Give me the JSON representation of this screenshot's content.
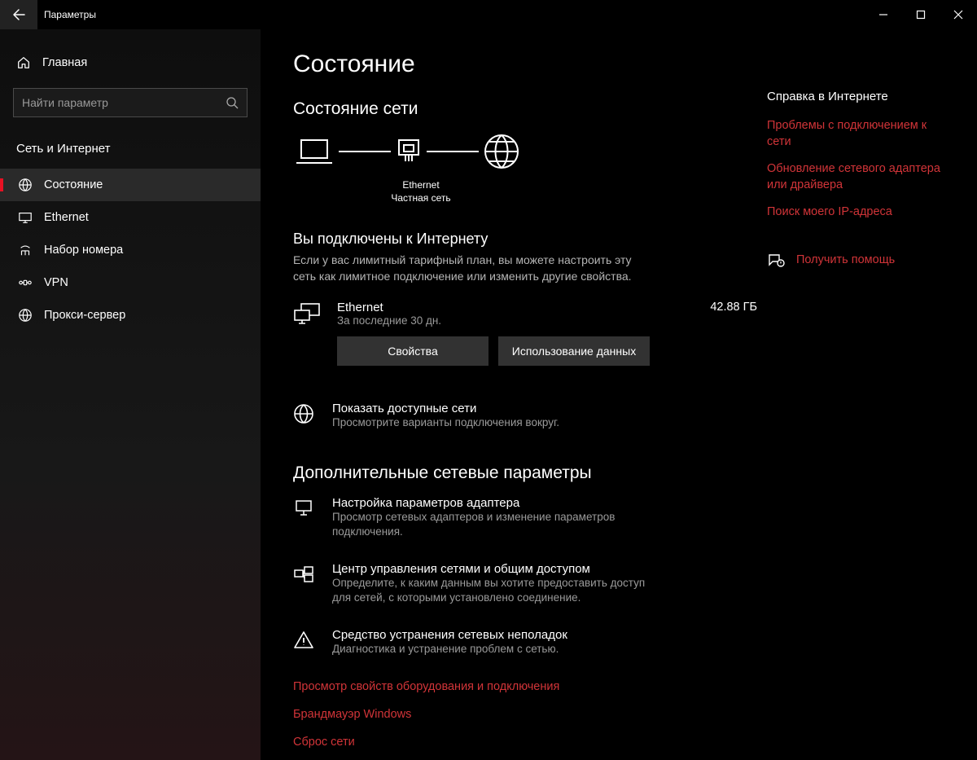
{
  "window": {
    "title": "Параметры"
  },
  "sidebar": {
    "home": "Главная",
    "search_placeholder": "Найти параметр",
    "category": "Сеть и Интернет",
    "items": [
      {
        "label": "Состояние",
        "selected": true
      },
      {
        "label": "Ethernet",
        "selected": false
      },
      {
        "label": "Набор номера",
        "selected": false
      },
      {
        "label": "VPN",
        "selected": false
      },
      {
        "label": "Прокси-сервер",
        "selected": false
      }
    ]
  },
  "main": {
    "page_title": "Состояние",
    "section_network_status": "Состояние сети",
    "diagram": {
      "middle_label": "Ethernet",
      "middle_sub": "Частная сеть"
    },
    "connected_title": "Вы подключены к Интернету",
    "connected_desc": "Если у вас лимитный тарифный план, вы можете настроить эту сеть как лимитное подключение или изменить другие свойства.",
    "conn": {
      "name": "Ethernet",
      "sub": "За последние 30 дн.",
      "usage": "42.88 ГБ",
      "btn_props": "Свойства",
      "btn_usage": "Использование данных"
    },
    "available": {
      "title": "Показать доступные сети",
      "desc": "Просмотрите варианты подключения вокруг."
    },
    "advanced_title": "Дополнительные сетевые параметры",
    "options": [
      {
        "title": "Настройка параметров адаптера",
        "desc": "Просмотр сетевых адаптеров и изменение параметров подключения."
      },
      {
        "title": "Центр управления сетями и общим доступом",
        "desc": "Определите, к каким данным вы хотите предоставить доступ для сетей, с которыми установлено соединение."
      },
      {
        "title": "Средство устранения сетевых неполадок",
        "desc": "Диагностика и устранение проблем с сетью."
      }
    ],
    "links": [
      "Просмотр свойств оборудования и подключения",
      "Брандмауэр Windows",
      "Сброс сети"
    ]
  },
  "right": {
    "title": "Справка в Интернете",
    "links": [
      "Проблемы с подключением к сети",
      "Обновление сетевого адаптера или драйвера",
      "Поиск моего IP-адреса"
    ],
    "help": "Получить помощь"
  }
}
